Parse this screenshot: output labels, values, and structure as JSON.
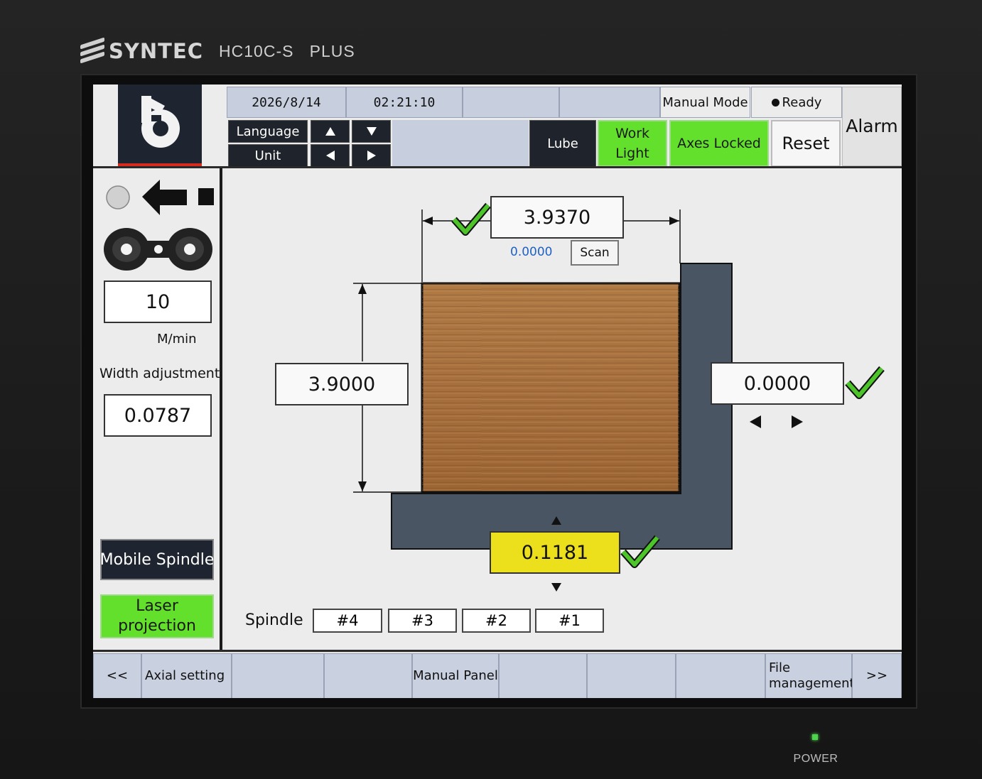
{
  "device": {
    "brand": "SYNTEC",
    "model": "HC10C-S",
    "model_suffix": "PLUS",
    "power_label": "POWER"
  },
  "header": {
    "date": "2026/8/14",
    "time": "02:21:10",
    "mode": "Manual Mode",
    "status": "Ready",
    "language_label": "Language",
    "unit_label": "Unit",
    "lube_label": "Lube",
    "work_light_label": "Work Light",
    "axes_locked_label": "Axes Locked",
    "reset_label": "Reset",
    "alarm_label": "Alarm"
  },
  "left_panel": {
    "speed_value": "10",
    "speed_unit": "M/min",
    "width_adjustment_label": "Width adjustment",
    "width_adjustment_value": "0.0787",
    "mobile_spindle_label": "Mobile Spindle",
    "laser_projection_label": "Laser projection"
  },
  "workpiece": {
    "top_width": "3.9370",
    "scan_value": "0.0000",
    "scan_label": "Scan",
    "left_height": "3.9000",
    "right_offset": "0.0000",
    "bottom_offset": "0.1181"
  },
  "spindles": {
    "label": "Spindle",
    "items": [
      "#4",
      "#3",
      "#2",
      "#1"
    ]
  },
  "bottom_nav": {
    "prev": "<<",
    "axial_setting": "Axial setting",
    "manual_panel": "Manual Panel",
    "file_management": "File management",
    "next": ">>"
  },
  "colors": {
    "accent_green": "#62e02c",
    "highlight_yellow": "#ecdf1c",
    "panel_blue_gray": "#c7cfdf",
    "fence_slate": "#4a5563",
    "scan_value_blue": "#1f62c4"
  }
}
